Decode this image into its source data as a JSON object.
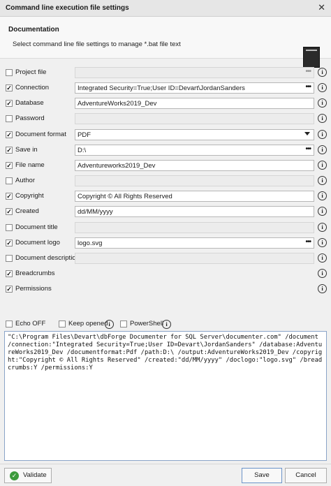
{
  "window": {
    "title": "Command line execution file settings",
    "close_glyph": "✕"
  },
  "header": {
    "title": "Documentation",
    "description": "Select command line file settings to manage *.bat file text",
    "icon": "document-icon"
  },
  "rows": [
    {
      "label": "Project file",
      "checked": false,
      "value": "",
      "control": "dots",
      "enabled": false
    },
    {
      "label": "Connection",
      "checked": true,
      "value": "Integrated Security=True;User ID=Devart\\JordanSanders",
      "control": "dots",
      "enabled": true
    },
    {
      "label": "Database",
      "checked": true,
      "value": "AdventureWorks2019_Dev",
      "control": "text",
      "enabled": true
    },
    {
      "label": "Password",
      "checked": false,
      "value": "",
      "control": "text",
      "enabled": false
    },
    {
      "label": "Document format",
      "checked": true,
      "value": "PDF",
      "control": "dropdown",
      "enabled": true
    },
    {
      "label": "Save in",
      "checked": true,
      "value": "D:\\",
      "control": "dots",
      "enabled": true
    },
    {
      "label": "File name",
      "checked": true,
      "value": "Adventureworks2019_Dev",
      "control": "text",
      "enabled": true
    },
    {
      "label": "Author",
      "checked": false,
      "value": "",
      "control": "text",
      "enabled": false
    },
    {
      "label": "Copyright",
      "checked": true,
      "value": "Copyright © All Rights Reserved",
      "control": "text",
      "enabled": true
    },
    {
      "label": "Created",
      "checked": true,
      "value": "dd/MM/yyyy",
      "control": "text",
      "enabled": true
    },
    {
      "label": "Document title",
      "checked": false,
      "value": "",
      "control": "text",
      "enabled": false
    },
    {
      "label": "Document logo",
      "checked": true,
      "value": "logo.svg",
      "control": "dots",
      "enabled": true
    },
    {
      "label": "Document description",
      "checked": false,
      "value": "",
      "control": "text",
      "enabled": false
    },
    {
      "label": "Breadcrumbs",
      "checked": true,
      "value": null,
      "control": "none",
      "enabled": true
    },
    {
      "label": "Permissions",
      "checked": true,
      "value": null,
      "control": "none",
      "enabled": true
    }
  ],
  "options": {
    "echo_off": {
      "label": "Echo OFF",
      "checked": false
    },
    "keep_opened": {
      "label": "Keep opened",
      "checked": false
    },
    "powershell": {
      "label": "PowerShell",
      "checked": false
    }
  },
  "command_text": "\"C:\\Program Files\\Devart\\dbForge Documenter for SQL Server\\documenter.com\" /document /connection:\"Integrated Security=True;User ID=Devart\\JordanSanders\" /database:AdventureWorks2019_Dev /documentformat:Pdf /path:D:\\ /output:AdventureWorks2019_Dev /copyright:\"Copyright © All Rights Reserved\" /created:\"dd/MM/yyyy\" /doclogo:\"logo.svg\" /breadcrumbs:Y /permissions:Y",
  "footer": {
    "validate": "Validate",
    "save": "Save",
    "cancel": "Cancel"
  },
  "colors": {
    "accent": "#6b93c8",
    "validate_icon": "#3c9a3c"
  }
}
